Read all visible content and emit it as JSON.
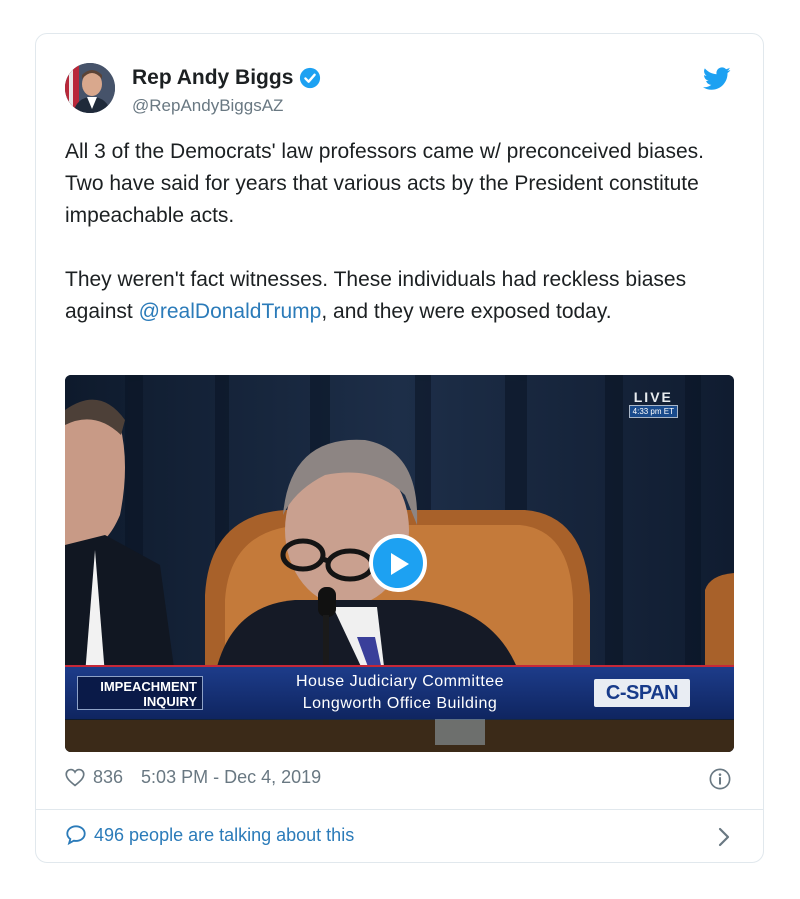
{
  "author": {
    "name": "Rep Andy Biggs",
    "handle": "@RepAndyBiggsAZ",
    "verified_icon": "verified-badge-icon",
    "avatar_icon": "profile-photo"
  },
  "platform_icon": "twitter-bird-icon",
  "tweet": {
    "paragraph1": "All 3 of the Democrats' law professors came w/ preconceived biases. Two have said for years that various acts by the President constitute impeachable acts.",
    "paragraph2_before": "They weren't fact witnesses. These individuals had reckless biases against ",
    "mention": "@realDonaldTrump",
    "paragraph2_after": ", and they were exposed today."
  },
  "video": {
    "live_label": "LIVE",
    "live_time": "4:33 pm ET",
    "banner_left": "IMPEACHMENT INQUIRY",
    "banner_line1": "House Judiciary Committee",
    "banner_line2": "Longworth Office Building",
    "network": "C-SPAN",
    "play_icon": "play-icon"
  },
  "footer": {
    "like_count": "836",
    "timestamp": "5:03 PM - Dec 4, 2019",
    "talking": "496 people are talking about this"
  },
  "colors": {
    "link": "#2b7bb9",
    "accent": "#1da1f2",
    "muted": "#697882"
  }
}
